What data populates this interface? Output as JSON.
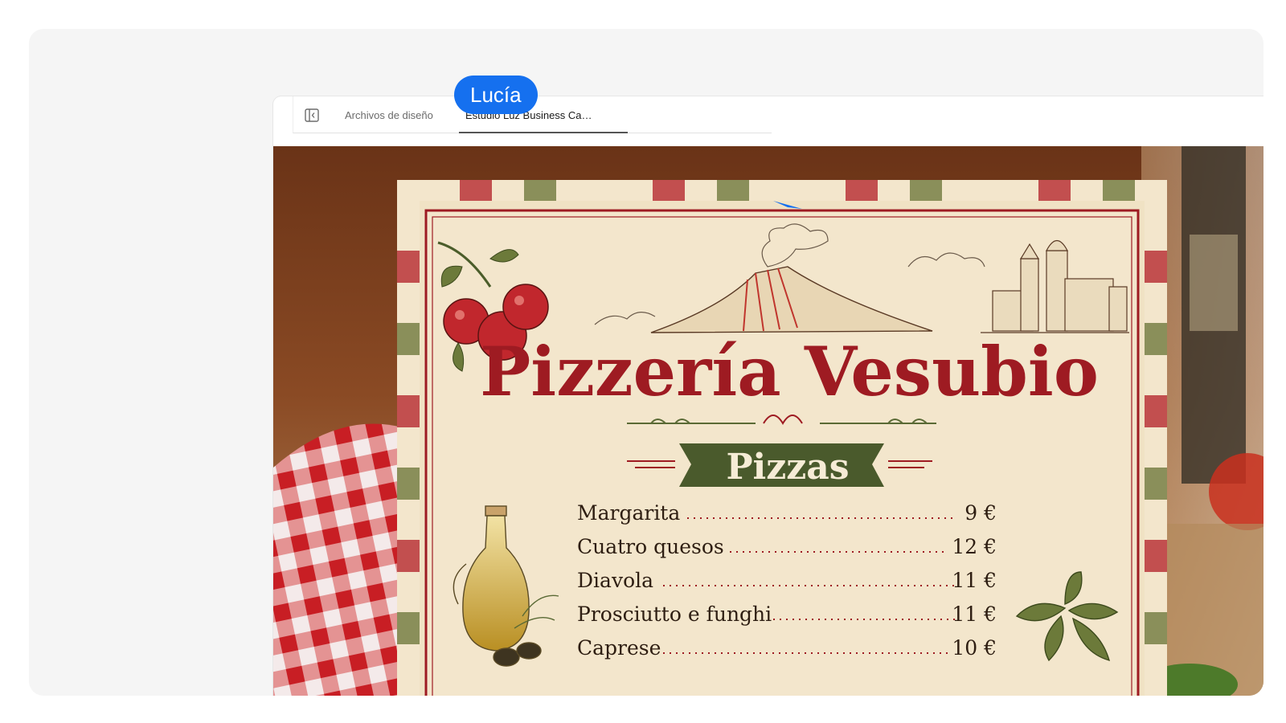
{
  "tabs": [
    {
      "label": "Archivos de diseño",
      "active": false
    },
    {
      "label": "Estudio Luz Business Ca…",
      "active": true
    }
  ],
  "collaborator": {
    "name": "Lucía",
    "color": "#1570ef"
  },
  "menu": {
    "title": "Pizzería Vesubio",
    "section": "Pizzas",
    "items": [
      {
        "name": "Margarita",
        "price": "9 €"
      },
      {
        "name": "Cuatro quesos",
        "price": "12 €"
      },
      {
        "name": "Diavola",
        "price": "11 €"
      },
      {
        "name": "Prosciutto e funghi",
        "price": "11 €"
      },
      {
        "name": "Caprese",
        "price": "10 €"
      }
    ]
  },
  "colors": {
    "menu_red": "#9e1b22",
    "menu_green": "#4a5a2c",
    "paper": "#f3e6cc",
    "cursor": "#1570ef"
  }
}
